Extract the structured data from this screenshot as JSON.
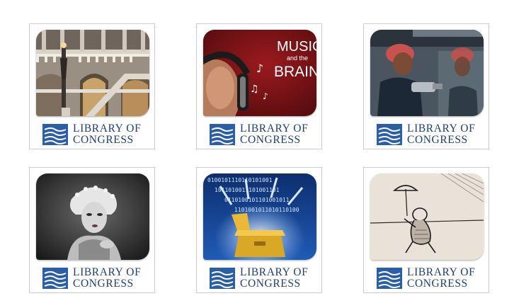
{
  "tiles": [
    {
      "name": "tile-library-interior",
      "art": "library-great-hall-photo",
      "logo": {
        "line1": "LIBRARY OF",
        "line2": "CONGRESS"
      }
    },
    {
      "name": "tile-music-and-the-brain",
      "art": "headphones-podcast-artwork",
      "art_text": {
        "line1": "MUSIC",
        "line2": "and the",
        "line3": "BRAIN"
      },
      "logo": {
        "line1": "LIBRARY OF",
        "line2": "CONGRESS"
      }
    },
    {
      "name": "tile-wartime-workers",
      "art": "women-factory-workers-photo",
      "logo": {
        "line1": "LIBRARY OF",
        "line2": "CONGRESS"
      }
    },
    {
      "name": "tile-1920s-portrait",
      "art": "vintage-woman-portrait-photo",
      "logo": {
        "line1": "LIBRARY OF",
        "line2": "CONGRESS"
      }
    },
    {
      "name": "tile-digital-box",
      "art": "binary-stream-box-artwork",
      "art_text": {
        "binary_1": "0100101110110101001",
        "binary_2": "1011010011101001101",
        "binary_3": "0110100101101001011",
        "binary_4": "1101001011010110100"
      },
      "logo": {
        "line1": "LIBRARY OF",
        "line2": "CONGRESS"
      }
    },
    {
      "name": "tile-comic-sketch",
      "art": "cartoon-umbrella-figure-drawing",
      "logo": {
        "line1": "LIBRARY OF",
        "line2": "CONGRESS"
      }
    }
  ],
  "colors": {
    "logo_blue": "#1f3f74",
    "flag_blue": "#2a5fa8",
    "tile_border": "#cfcfcf"
  }
}
